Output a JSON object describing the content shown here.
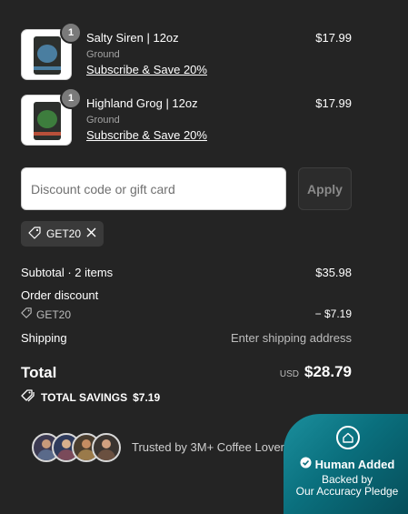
{
  "cart": {
    "items": [
      {
        "name": "Salty Siren | 12oz",
        "variant": "Ground",
        "subscribe": "Subscribe & Save 20%",
        "price": "$17.99",
        "quantity": "1",
        "label_color": "#4a7ea0"
      },
      {
        "name": "Highland Grog | 12oz",
        "variant": "Ground",
        "subscribe": "Subscribe & Save 20%",
        "price": "$17.99",
        "quantity": "1",
        "label_color": "#3d7d3d"
      }
    ]
  },
  "discount": {
    "placeholder": "Discount code or gift card",
    "apply_label": "Apply",
    "applied_code": "GET20"
  },
  "summary": {
    "subtotal_label": "Subtotal · 2 items",
    "subtotal_value": "$35.98",
    "order_discount_label": "Order discount",
    "discount_code": "GET20",
    "discount_value": "− $7.19",
    "shipping_label": "Shipping",
    "shipping_value": "Enter shipping address",
    "total_label": "Total",
    "currency": "USD",
    "total_value": "$28.79",
    "total_savings_label": "TOTAL SAVINGS",
    "total_savings_value": "$7.19"
  },
  "trust": {
    "text": "Trusted by 3M+ Coffee Lovers"
  },
  "pledge": {
    "title": "Human Added",
    "line1": "Backed by",
    "line2": "Our Accuracy Pledge"
  },
  "colors": {
    "background": "#242424",
    "pledge_gradient_start": "#1b8f9d",
    "pledge_gradient_end": "#064d59",
    "muted_text": "#bdbdbd"
  }
}
